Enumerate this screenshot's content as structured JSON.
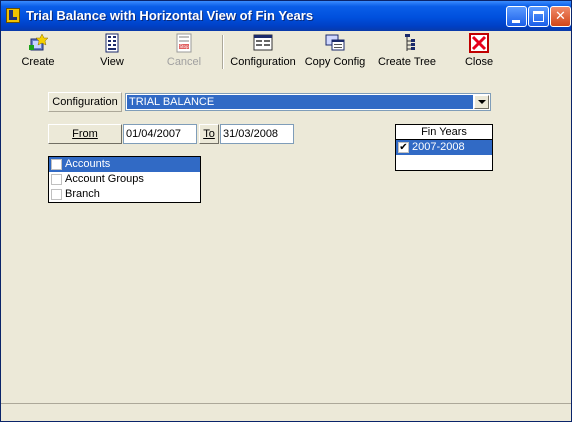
{
  "window": {
    "title": "Trial Balance with Horizontal View of Fin Years"
  },
  "toolbar": {
    "create": "Create",
    "view": "View",
    "cancel": "Cancel",
    "configuration": "Configuration",
    "copy_config": "Copy Config",
    "create_tree": "Create Tree",
    "close": "Close"
  },
  "form": {
    "configuration_label": "Configuration",
    "configuration_value": "TRIAL BALANCE",
    "from_button": "From",
    "from_date": "01/04/2007",
    "to_button": "To",
    "to_date": "31/03/2008"
  },
  "group_list": {
    "items": [
      {
        "label": "Accounts",
        "selected": true,
        "checked": false
      },
      {
        "label": "Account Groups",
        "selected": false,
        "checked": false
      },
      {
        "label": "Branch",
        "selected": false,
        "checked": false
      }
    ]
  },
  "fin_years": {
    "header": "Fin Years",
    "items": [
      {
        "label": "2007-2008",
        "checked": true,
        "check_glyph": "✔"
      }
    ]
  },
  "colors": {
    "title_bar": "#0054e3",
    "selection": "#316ac5",
    "face": "#ece9d8",
    "close_red": "#e8001c"
  }
}
